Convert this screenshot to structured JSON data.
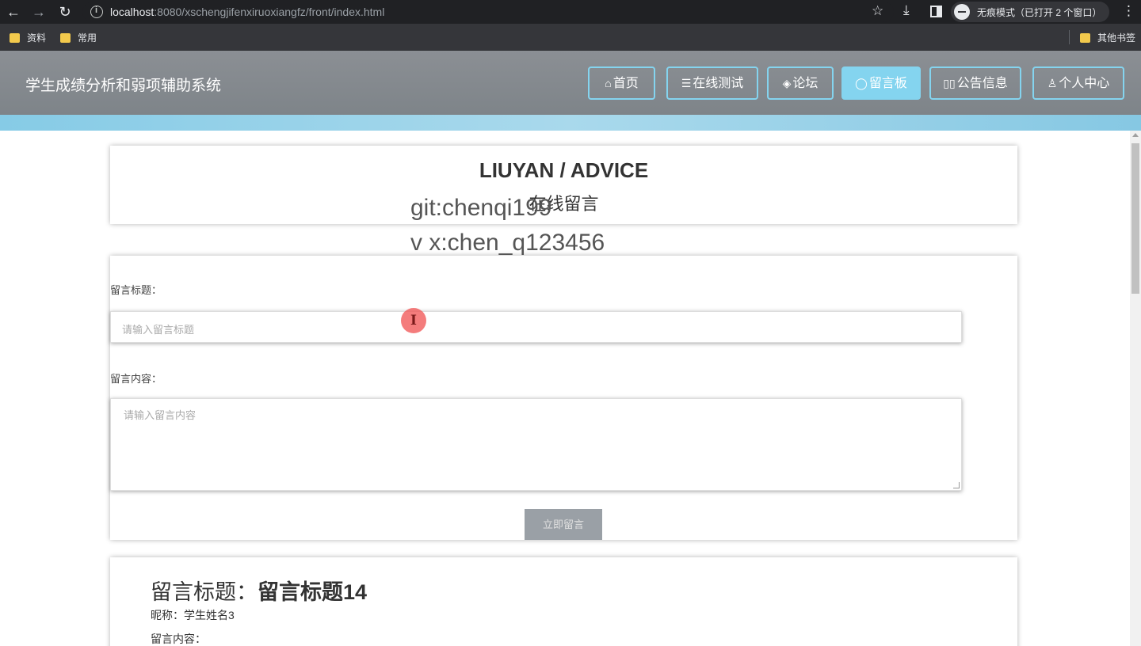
{
  "browser": {
    "url_host": "localhost",
    "url_rest": ":8080/xschengjifenxiruoxiangfz/front/index.html",
    "incognito_label": "无痕模式（已打开 2 个窗口）",
    "bookmarks": [
      "资料",
      "常用"
    ],
    "other_bookmarks": "其他书签"
  },
  "header": {
    "site_title": "学生成绩分析和弱项辅助系统",
    "nav": [
      {
        "icon": "⌂",
        "label": "首页"
      },
      {
        "icon": "☰",
        "label": "在线测试"
      },
      {
        "icon": "◈",
        "label": "论坛"
      },
      {
        "icon": "◯",
        "label": "留言板"
      },
      {
        "icon": "▯▯",
        "label": "公告信息"
      },
      {
        "icon": "♙",
        "label": "个人中心"
      }
    ],
    "active_nav": "留言板"
  },
  "hero": {
    "title": "LIUYAN / ADVICE",
    "subtitle": "在线留言",
    "watermark_line1": "git:chenqi199",
    "watermark_line2": "v x:chen_q123456"
  },
  "form": {
    "title_label": "留言标题：",
    "title_placeholder": "请输入留言标题",
    "content_label": "留言内容：",
    "content_placeholder": "请输入留言内容",
    "submit_label": "立即留言"
  },
  "message": {
    "title_prefix": "留言标题：",
    "title_value": "留言标题14",
    "nickname": "昵称：学生姓名3",
    "content_label": "留言内容："
  }
}
